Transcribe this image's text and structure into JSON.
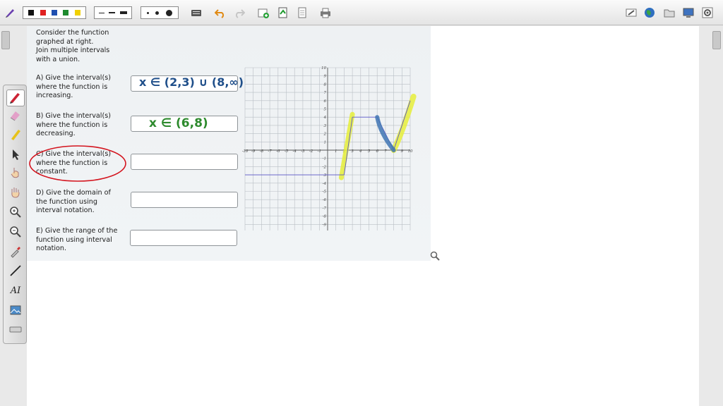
{
  "toolbar": {
    "colors": [
      "#111111",
      "#e02020",
      "#1f4fb0",
      "#1e8a2e",
      "#f0d000"
    ],
    "icons": [
      "pen-icon",
      "color-palette",
      "line-width",
      "dot-size",
      "keyboard-icon",
      "undo-icon",
      "redo-icon",
      "add-page-icon",
      "export-icon",
      "page-icon",
      "print-icon",
      "eraser-icon",
      "globe-icon",
      "folder-icon",
      "monitor-icon",
      "settings-icon"
    ]
  },
  "palette": {
    "icons": [
      "pen-tool-icon",
      "eraser-tool-icon",
      "highlighter-tool-icon",
      "select-arrow-icon",
      "pointer-hand-icon",
      "pan-hand-icon",
      "zoom-in-icon",
      "zoom-out-icon",
      "eyedropper-icon",
      "line-tool-icon",
      "text-tool-icon",
      "image-tool-icon",
      "keyboard-tool-icon"
    ],
    "text_tool_label": "AI"
  },
  "worksheet": {
    "intro": [
      "Consider the function",
      "graphed at right.",
      "Join multiple intervals",
      "with a union."
    ],
    "questions": [
      {
        "lines": [
          "A)  Give the interval(s)",
          "where the function is",
          "increasing."
        ]
      },
      {
        "lines": [
          "B)  Give the interval(s)",
          "where the function is",
          "decreasing."
        ]
      },
      {
        "lines": [
          "C)  Give the interval(s)",
          "where the function is",
          "constant."
        ]
      },
      {
        "lines": [
          "D)  Give the domain of",
          "the function using",
          "interval notation."
        ]
      },
      {
        "lines": [
          "E)  Give the range of the",
          "function using interval",
          "notation."
        ]
      }
    ],
    "answers": {
      "a": "x ∈ (2,3) ∪ (8,∞)",
      "b": "x ∈ (6,8)",
      "c": "",
      "d": "",
      "e": ""
    }
  },
  "graph": {
    "x_ticks": [
      "-10",
      "-9",
      "-8",
      "-7",
      "-6",
      "-5",
      "-4",
      "-3",
      "-2",
      "-1",
      "1",
      "2",
      "3",
      "4",
      "5",
      "6",
      "7",
      "8",
      "9",
      "10"
    ],
    "y_ticks_top": [
      "10",
      "9",
      "8",
      "7",
      "6",
      "5",
      "4",
      "3",
      "2",
      "1"
    ],
    "y_ticks_bottom": [
      "-1",
      "-2",
      "-3",
      "-4",
      "-5",
      "-6",
      "-7",
      "-8",
      "-9",
      "-10"
    ],
    "function_segments": [
      {
        "x": [
          -10,
          2
        ],
        "y": [
          -3,
          -3
        ]
      },
      {
        "x": [
          2,
          3
        ],
        "y": [
          -3,
          4
        ]
      },
      {
        "x": [
          3,
          6
        ],
        "y": [
          4,
          4
        ]
      },
      {
        "x": [
          6,
          8
        ],
        "y": [
          4,
          0
        ]
      },
      {
        "x": [
          8,
          10
        ],
        "y": [
          0,
          6
        ]
      }
    ],
    "highlight_colors": {
      "increasing": "#e6ef3a",
      "decreasing": "#3f74b3"
    }
  }
}
